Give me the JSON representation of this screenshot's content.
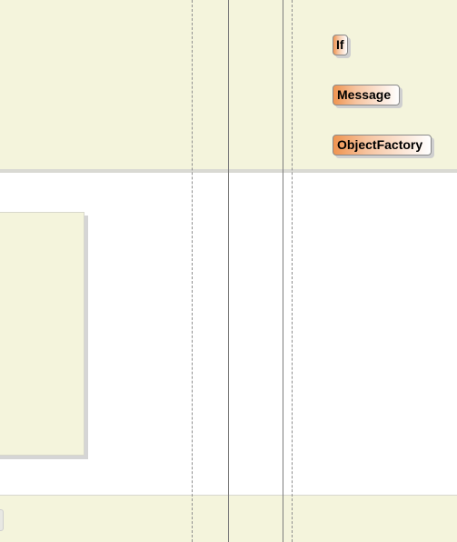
{
  "nodes": {
    "if_label": "If",
    "message_label": "Message",
    "object_factory_label": "ObjectFactory"
  },
  "colors": {
    "band": "#f4f4dc",
    "node_gradient_start": "#ef9450",
    "node_gradient_end": "#ffffff",
    "lifeline": "#8e8e8e"
  }
}
